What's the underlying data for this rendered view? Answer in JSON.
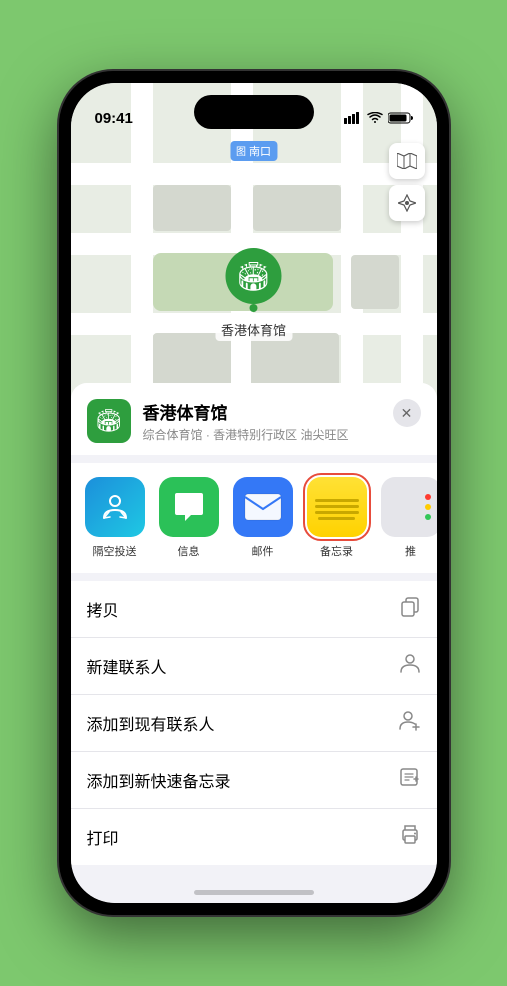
{
  "statusBar": {
    "time": "09:41",
    "signal": "▌▌▌",
    "wifi": "wifi",
    "battery": "battery"
  },
  "map": {
    "label": "南口",
    "venuePin": {
      "name": "香港体育馆"
    }
  },
  "venueCard": {
    "name": "香港体育馆",
    "subtitle": "综合体育馆 · 香港特别行政区 油尖旺区",
    "closeLabel": "✕"
  },
  "shareApps": [
    {
      "id": "airdrop",
      "label": "隔空投送"
    },
    {
      "id": "message",
      "label": "信息"
    },
    {
      "id": "mail",
      "label": "邮件"
    },
    {
      "id": "notes",
      "label": "备忘录"
    },
    {
      "id": "more",
      "label": "推"
    }
  ],
  "actions": [
    {
      "id": "copy",
      "label": "拷贝",
      "icon": "copy"
    },
    {
      "id": "new-contact",
      "label": "新建联系人",
      "icon": "person"
    },
    {
      "id": "add-contact",
      "label": "添加到现有联系人",
      "icon": "person-add"
    },
    {
      "id": "add-notes",
      "label": "添加到新快速备忘录",
      "icon": "notes"
    },
    {
      "id": "print",
      "label": "打印",
      "icon": "printer"
    }
  ]
}
